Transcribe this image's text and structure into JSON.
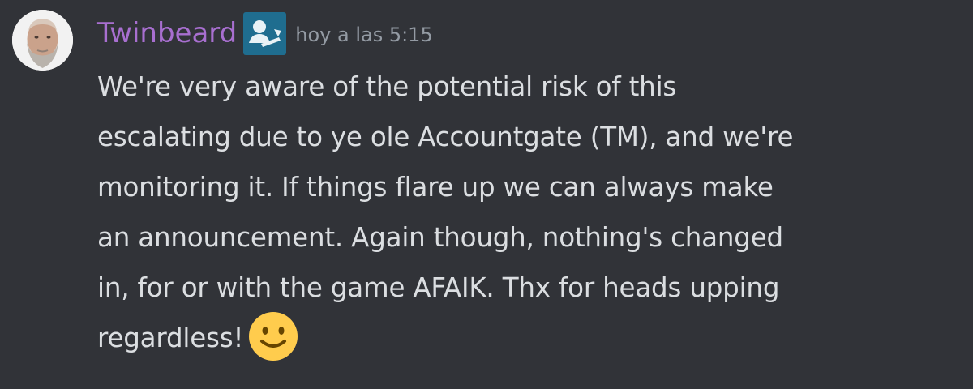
{
  "message": {
    "author": "Twinbeard",
    "timestamp": "hoy a las 5:15",
    "author_color": "#a86fd0",
    "role_icon": "person-role-icon",
    "avatar": "bearded-man-avatar",
    "lines": [
      "We're very aware of the potential risk of this",
      "escalating due to ye ole Accountgate (TM), and we're",
      "monitoring it. If things flare up we can always make",
      "an announcement. Again though, nothing's changed",
      "in, for or with the game AFAIK. Thx for heads upping",
      "regardless!"
    ],
    "trailing_emoji": "slightly-smiling-face-emoji"
  },
  "theme": {
    "background": "#313338",
    "text": "#dbdee1",
    "timestamp": "#949ba4",
    "role_icon_bg": "#1f6d8f"
  }
}
